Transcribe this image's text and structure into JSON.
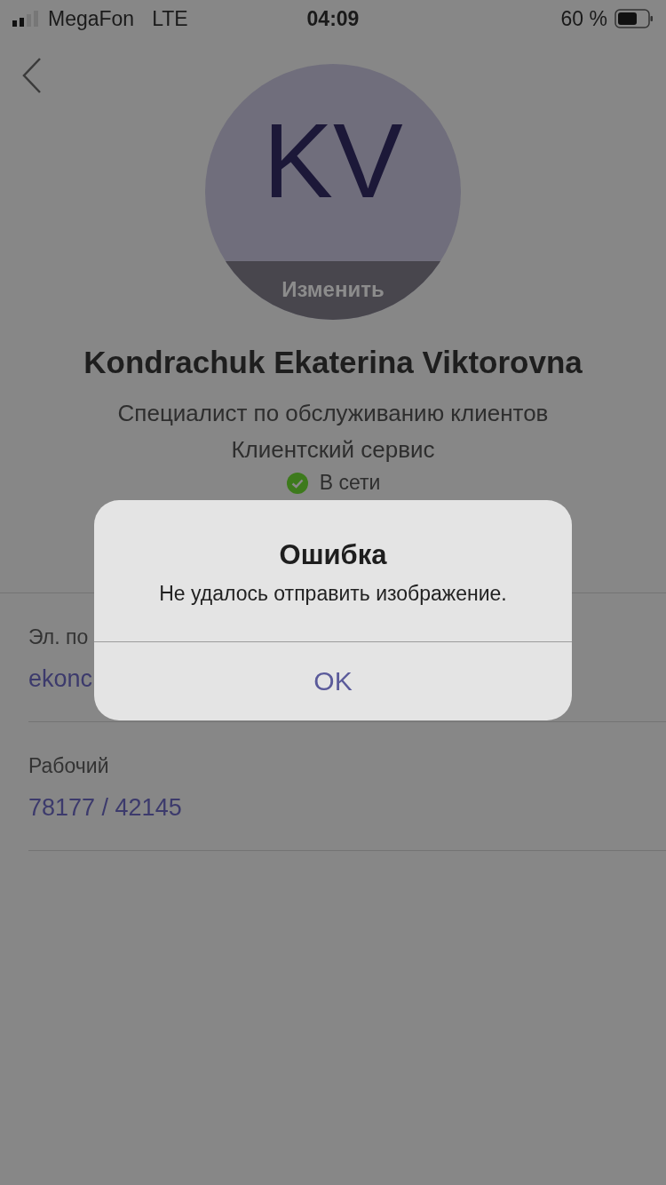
{
  "status_bar": {
    "carrier": "MegaFon",
    "network": "LTE",
    "time": "04:09",
    "battery": "60 %"
  },
  "profile": {
    "initials": "KV",
    "change_label": "Изменить",
    "name": "Kondrachuk Ekaterina Viktorovna",
    "position": "Специалист по обслуживанию клиентов",
    "department": "Клиентский сервис",
    "presence": {
      "label": "В сети",
      "online": true
    }
  },
  "contacts": [
    {
      "label": "Эл. по",
      "value": "ekonc"
    },
    {
      "label": "Рабочий",
      "value": "78177 / 42145"
    }
  ],
  "alert": {
    "title": "Ошибка",
    "message": "Не удалось отправить изображение.",
    "button": "OK"
  }
}
